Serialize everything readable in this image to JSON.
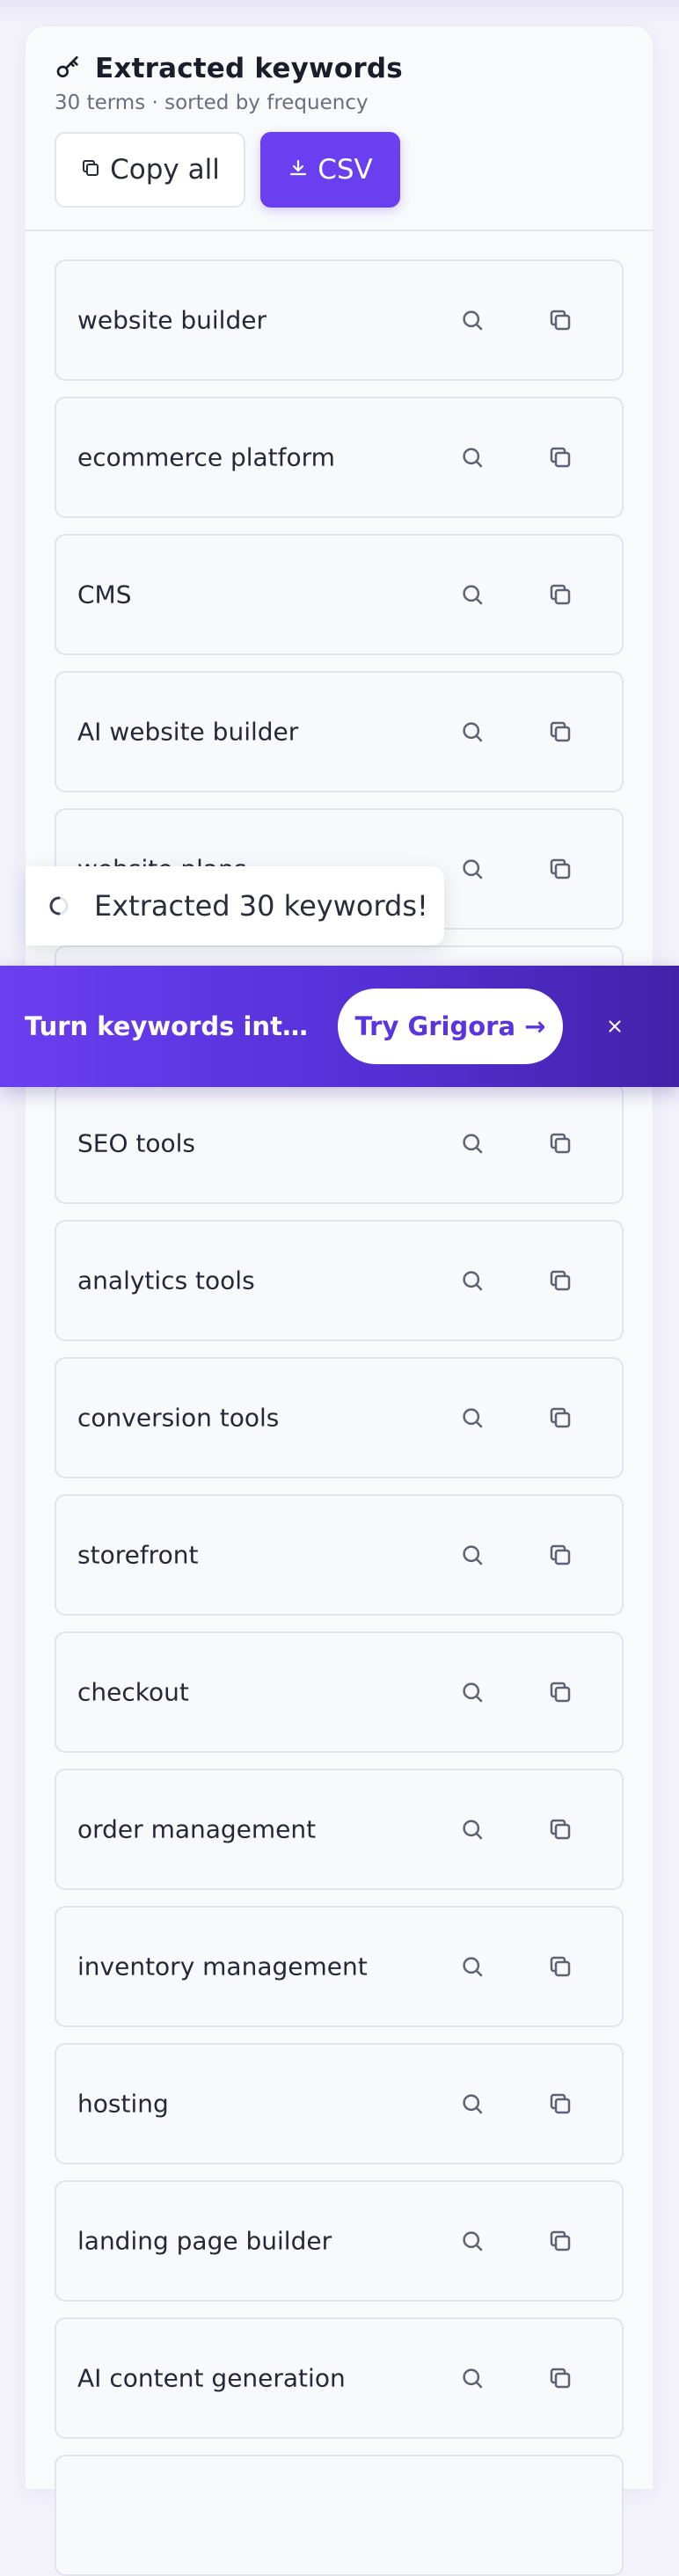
{
  "header": {
    "title": "Extracted keywords",
    "title_icon": "key-icon",
    "subtitle": "30 terms · sorted by frequency",
    "copy_all_label": "Copy all",
    "csv_label": "CSV"
  },
  "keywords": [
    "website builder",
    "ecommerce platform",
    "CMS",
    "AI website builder",
    "website plans",
    "",
    "SEO tools",
    "analytics tools",
    "conversion tools",
    "storefront",
    "checkout",
    "order management",
    "inventory management",
    "hosting",
    "landing page builder",
    "AI content generation",
    ""
  ],
  "toast": {
    "text": "Extracted 30 keywords!"
  },
  "promo": {
    "text": "Turn keywords into co...",
    "cta_label": "Try Grigora →",
    "close_label": "×"
  },
  "colors": {
    "accent": "#6a3ff0",
    "promo_gradient_end": "#4322a8",
    "card_bg": "#f9fafc",
    "page_bg": "#f3f2fb"
  }
}
